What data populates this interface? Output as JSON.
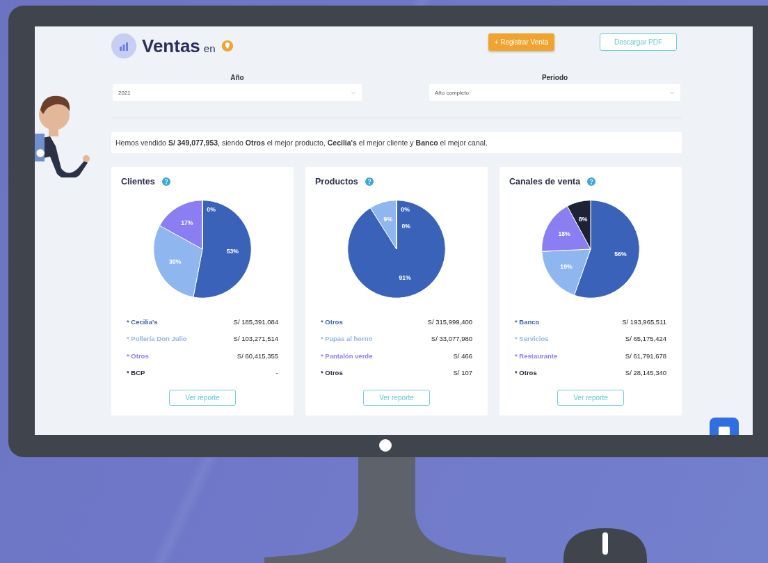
{
  "header": {
    "title": "Ventas",
    "subtitle": "en"
  },
  "buttons": [
    {
      "label": "+ Registrar Venta",
      "kind": "primary"
    },
    {
      "label": "Descargar PDF",
      "kind": "outline"
    }
  ],
  "filters": [
    {
      "label": "Año",
      "value": "2021"
    },
    {
      "label": "Periodo",
      "value": "Año completo"
    }
  ],
  "summary": "Hemos vendido **S/ 349,077,953**, siendo **Otros** el mejor producto, **Cecilia's** el mejor cliente y **Banco** el mejor canal.",
  "cards": [
    {
      "title": "Clientes",
      "chart_data": {
        "type": "pie",
        "categories": [
          "Cecilia's",
          "Pollería Don Julio",
          "Otros",
          "BCP"
        ],
        "values": [
          53,
          30,
          17,
          0
        ],
        "value_labels": [
          "53%",
          "30%",
          "17%",
          "0%"
        ]
      },
      "legend": [
        {
          "bullet": "*",
          "value": "S/ 185,391,084",
          "color": "#3a62b8"
        },
        {
          "bullet": "*",
          "value": "S/ 103,271,514",
          "color": "#8fb6ee"
        },
        {
          "bullet": "*",
          "value": "S/ 60,415,355",
          "color": "#8a7ef2"
        },
        {
          "bullet": "*",
          "value": "-",
          "color": "#1e2235"
        }
      ],
      "button": "Ver reporte"
    },
    {
      "title": "Productos",
      "chart_data": {
        "type": "pie",
        "categories": [
          "Otros",
          "Papas al horno",
          "Pantalón verde",
          "Otros"
        ],
        "values": [
          91,
          9,
          0,
          0
        ],
        "value_labels": [
          "91%",
          "9%",
          "0%",
          "0%"
        ]
      },
      "legend": [
        {
          "bullet": "*",
          "value": "S/ 315,999,400",
          "color": "#3a62b8"
        },
        {
          "bullet": "*",
          "value": "S/ 33,077,980",
          "color": "#8fb6ee"
        },
        {
          "bullet": "*",
          "value": "S/ 466",
          "color": "#8a7ef2"
        },
        {
          "bullet": "*",
          "value": "S/ 107",
          "color": "#1e2235"
        }
      ],
      "button": "Ver reporte"
    },
    {
      "title": "Canales de venta",
      "chart_data": {
        "type": "pie",
        "categories": [
          "Banco",
          "Servicios",
          "Restaurante",
          "Otros"
        ],
        "values": [
          56,
          19,
          18,
          8
        ],
        "value_labels": [
          "56%",
          "19%",
          "18%",
          "8%"
        ]
      },
      "legend": [
        {
          "bullet": "*",
          "value": "S/ 193,965,511",
          "color": "#3a62b8"
        },
        {
          "bullet": "*",
          "value": "S/ 65,175,424",
          "color": "#8fb6ee"
        },
        {
          "bullet": "*",
          "value": "S/ 61,791,678",
          "color": "#8a7ef2"
        },
        {
          "bullet": "*",
          "value": "S/ 28,145,340",
          "color": "#1e2235"
        }
      ],
      "button": "Ver reporte"
    }
  ]
}
